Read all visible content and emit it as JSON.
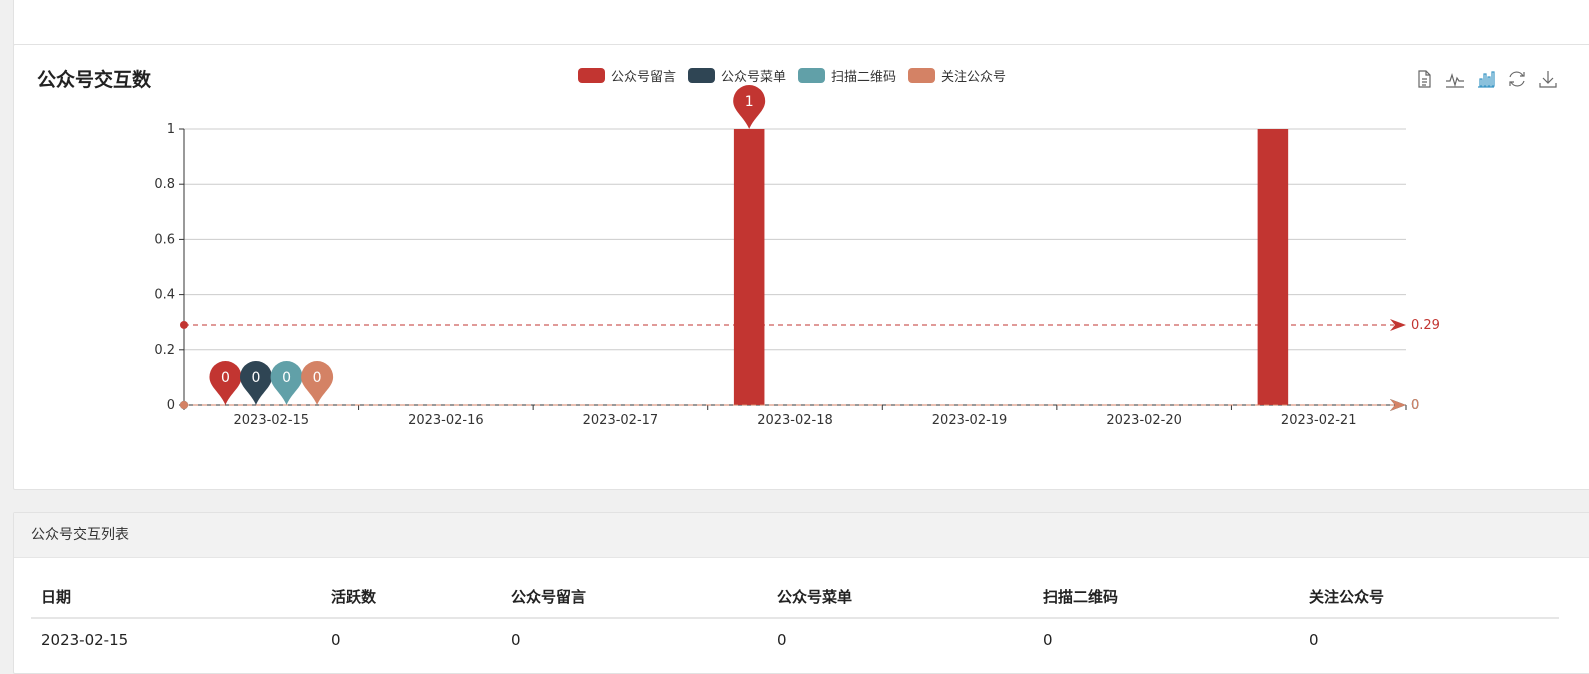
{
  "chart_card": {
    "title": "公众号交互数",
    "legend": [
      {
        "label": "公众号留言",
        "color": "#c23531"
      },
      {
        "label": "公众号菜单",
        "color": "#2f4554"
      },
      {
        "label": "扫描二维码",
        "color": "#61a0a8"
      },
      {
        "label": "关注公众号",
        "color": "#d48265"
      }
    ],
    "toolbox": [
      "data-view-icon",
      "line-chart-icon",
      "bar-chart-icon",
      "restore-icon",
      "download-icon"
    ]
  },
  "chart_data": {
    "type": "bar",
    "categories": [
      "2023-02-15",
      "2023-02-16",
      "2023-02-17",
      "2023-02-18",
      "2023-02-19",
      "2023-02-20",
      "2023-02-21"
    ],
    "ylim": [
      0,
      1
    ],
    "yticks": [
      "0",
      "0.2",
      "0.4",
      "0.6",
      "0.8",
      "1"
    ],
    "series": [
      {
        "name": "公众号留言",
        "color": "#c23531",
        "values": [
          0,
          0,
          0,
          1,
          0,
          0,
          1
        ],
        "average": 0.29,
        "average_label": "0.29"
      },
      {
        "name": "公众号菜单",
        "color": "#2f4554",
        "values": [
          0,
          0,
          0,
          0,
          0,
          0,
          0
        ],
        "average": 0,
        "average_label": "0"
      },
      {
        "name": "扫描二维码",
        "color": "#61a0a8",
        "values": [
          0,
          0,
          0,
          0,
          0,
          0,
          0
        ],
        "average": 0,
        "average_label": "0"
      },
      {
        "name": "关注公众号",
        "color": "#d48265",
        "values": [
          0,
          0,
          0,
          0,
          0,
          0,
          0
        ],
        "average": 0,
        "average_label": "0"
      }
    ],
    "max_pins": [
      {
        "category": "2023-02-18",
        "series": "公众号留言",
        "value": "1"
      }
    ],
    "min_pins": [
      {
        "category": "2023-02-15",
        "series": "公众号留言",
        "value": "0"
      },
      {
        "category": "2023-02-15",
        "series": "公众号菜单",
        "value": "0"
      },
      {
        "category": "2023-02-15",
        "series": "扫描二维码",
        "value": "0"
      },
      {
        "category": "2023-02-15",
        "series": "关注公众号",
        "value": "0"
      }
    ]
  },
  "table_card": {
    "title": "公众号交互列表",
    "columns": [
      "日期",
      "活跃数",
      "公众号留言",
      "公众号菜单",
      "扫描二维码",
      "关注公众号"
    ],
    "rows": [
      [
        "2023-02-15",
        "0",
        "0",
        "0",
        "0",
        "0"
      ]
    ]
  }
}
